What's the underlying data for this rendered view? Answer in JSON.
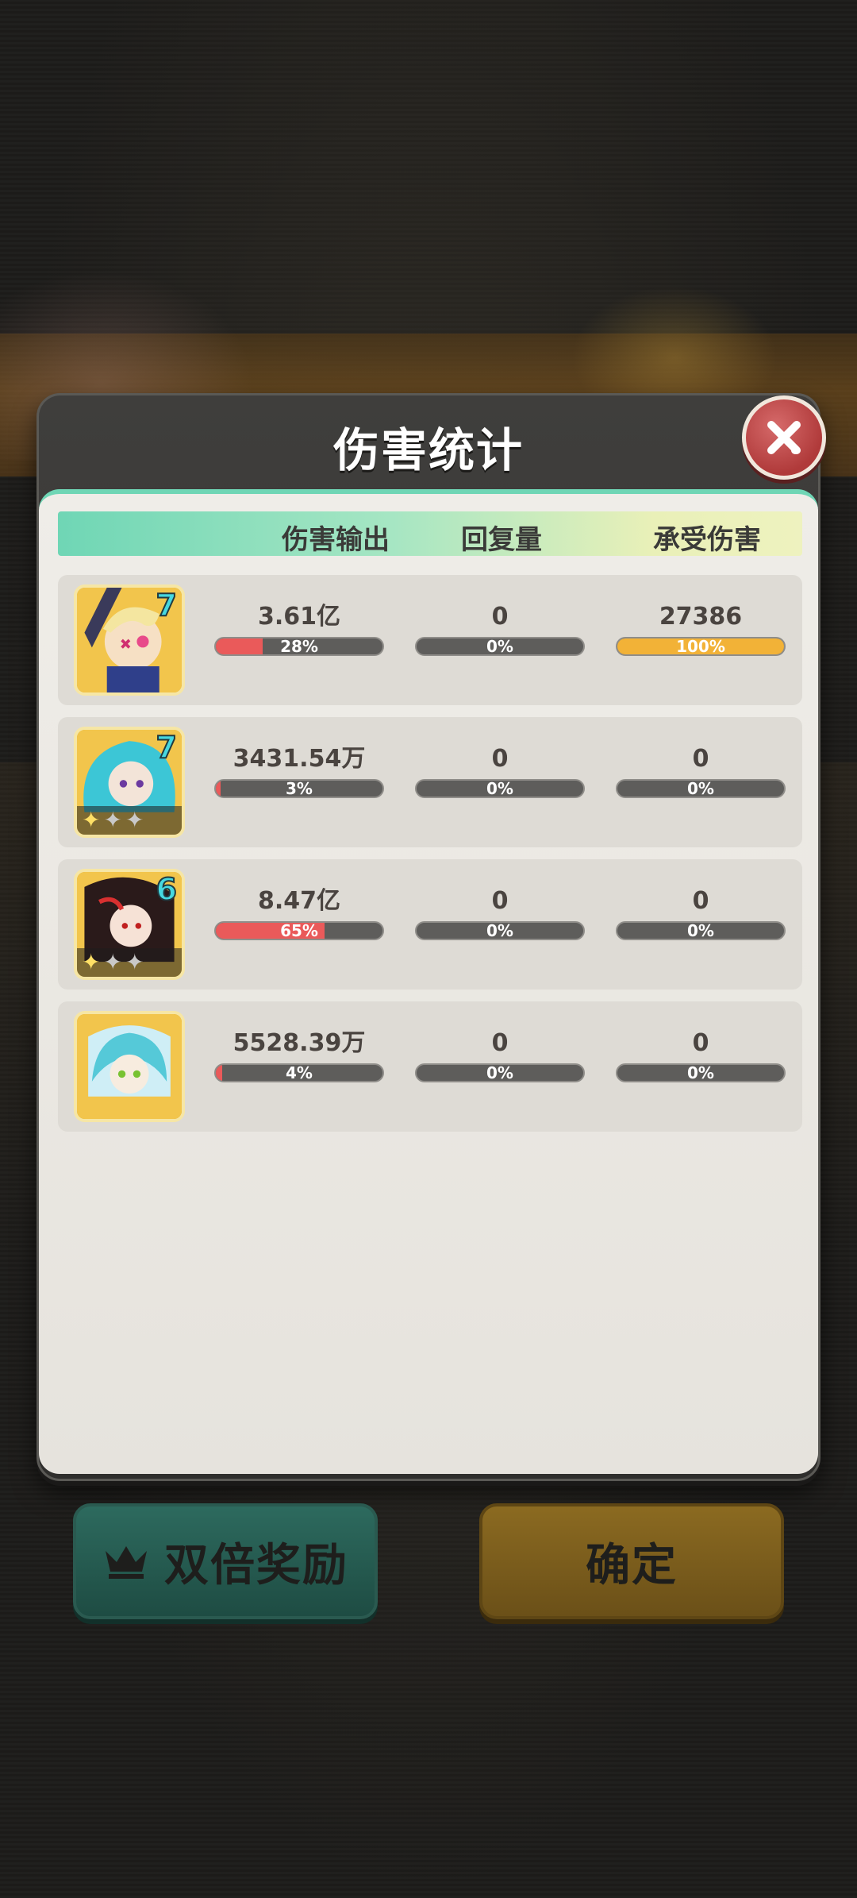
{
  "modal": {
    "title": "伤害统计"
  },
  "columns": {
    "damage": "伤害输出",
    "heal": "回复量",
    "taken": "承受伤害"
  },
  "rows": [
    {
      "avatar_level": "7",
      "stars": [],
      "damage": {
        "value": "3.61亿",
        "percent": "28%",
        "fraction": 0.28
      },
      "heal": {
        "value": "0",
        "percent": "0%",
        "fraction": 0
      },
      "taken": {
        "value": "27386",
        "percent": "100%",
        "fraction": 1.0
      }
    },
    {
      "avatar_level": "7",
      "stars": [
        "on",
        "off",
        "off"
      ],
      "damage": {
        "value": "3431.54万",
        "percent": "3%",
        "fraction": 0.03
      },
      "heal": {
        "value": "0",
        "percent": "0%",
        "fraction": 0
      },
      "taken": {
        "value": "0",
        "percent": "0%",
        "fraction": 0
      }
    },
    {
      "avatar_level": "6",
      "stars": [
        "on",
        "off",
        "off"
      ],
      "damage": {
        "value": "8.47亿",
        "percent": "65%",
        "fraction": 0.65
      },
      "heal": {
        "value": "0",
        "percent": "0%",
        "fraction": 0
      },
      "taken": {
        "value": "0",
        "percent": "0%",
        "fraction": 0
      }
    },
    {
      "avatar_level": "",
      "stars": [],
      "damage": {
        "value": "5528.39万",
        "percent": "4%",
        "fraction": 0.04
      },
      "heal": {
        "value": "0",
        "percent": "0%",
        "fraction": 0
      },
      "taken": {
        "value": "0",
        "percent": "0%",
        "fraction": 0
      }
    }
  ],
  "buttons": {
    "double_reward": "双倍奖励",
    "confirm": "确定"
  },
  "colors": {
    "damage_bar": "#ea5a5a",
    "taken_bar": "#f2b237",
    "header_gradient_start": "#6fd6b5",
    "close_button": "#c04848"
  },
  "icons": {
    "close": "close-x-icon",
    "crown": "crown-icon"
  }
}
